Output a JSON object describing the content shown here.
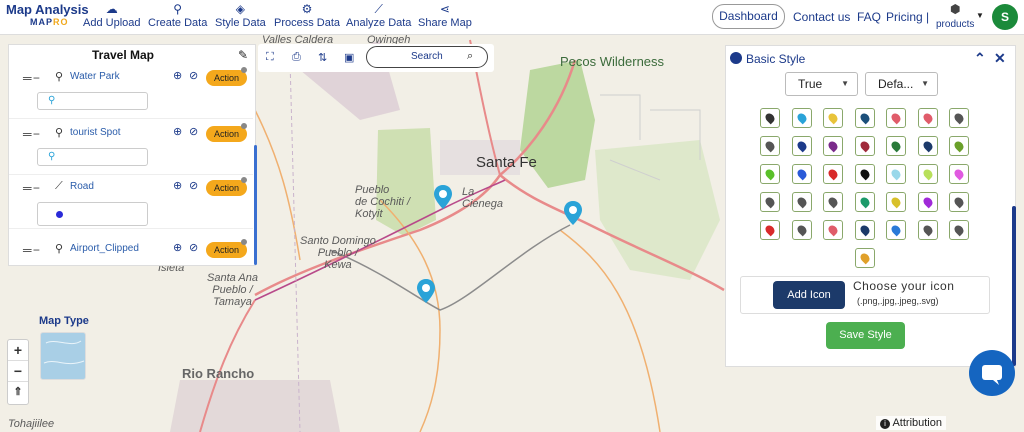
{
  "app": {
    "logo_title": "Map Analysis",
    "logo_sub_a": "MAP",
    "logo_sub_b": "RO"
  },
  "nav": {
    "items": [
      {
        "label": "Add Upload",
        "icon": "cloud-upload-icon"
      },
      {
        "label": "Create Data",
        "icon": "location-pin-icon"
      },
      {
        "label": "Style Data",
        "icon": "paint-bucket-icon"
      },
      {
        "label": "Process Data",
        "icon": "process-icon"
      },
      {
        "label": "Analyze Data",
        "icon": "analyze-icon"
      },
      {
        "label": "Share Map",
        "icon": "share-icon"
      }
    ],
    "dashboard": "Dashboard",
    "contact": "Contact us",
    "faq": "FAQ",
    "pricing": "Pricing |",
    "products": "products",
    "avatar_initial": "S"
  },
  "layer_panel": {
    "title": "Travel Map",
    "action_label": "Action",
    "layers": [
      {
        "name": "Water Park",
        "type": "point"
      },
      {
        "name": "tourist Spot",
        "type": "point"
      },
      {
        "name": "Road",
        "type": "line"
      },
      {
        "name": "Airport_Clipped",
        "type": "point"
      }
    ]
  },
  "tools": {
    "search_placeholder": "Search"
  },
  "style_panel": {
    "title": "Basic Style",
    "dropdown_1": "True",
    "dropdown_2": "Defa...",
    "add_icon": "Add Icon",
    "choose_title": "Choose your icon",
    "choose_formats": "(.png,.jpg,.jpeg,.svg)",
    "save_style": "Save Style",
    "icon_colors": [
      "#333333",
      "#2aa3d8",
      "#e8c33a",
      "#1c4f7a",
      "#e05c6a",
      "#e05c6a",
      "#555555",
      "#555555",
      "#1c3a8a",
      "#7a2a8a",
      "#a02a3a",
      "#2a7a3a",
      "#1c3a6a",
      "#6aa02a",
      "#5ac02a",
      "#2a5ad8",
      "#d82a2a",
      "#111111",
      "#9ad8ea",
      "#b8e05a",
      "#e05ae0",
      "#555555",
      "#555555",
      "#555555",
      "#1c9a6a",
      "#d8c02a",
      "#a02ad8",
      "#555555",
      "#d82a2a",
      "#555555",
      "#e05c6a",
      "#1c3a6a",
      "#2a7ad8",
      "#555555",
      "#555555",
      "#e0a02a"
    ]
  },
  "map": {
    "labels": {
      "santa_fe": "Santa Fe",
      "pecos": "Pecos Wilderness",
      "rio_rancho": "Rio Rancho",
      "cochiti": "Pueblo\nde Cochiti /\nKotyit",
      "santo_domingo": "Santo Domingo\nPueblo /\nKewa",
      "santa_ana": "Santa Ana\nPueblo /\nTamaya",
      "la_cienega": "La\nCienega",
      "owingeh": "Owingeh",
      "valles": "Valles Caldera",
      "tohajiilee": "Tohajiilee",
      "isleta": "Isleta"
    },
    "map_type_label": "Map Type",
    "attribution": "Attribution"
  }
}
